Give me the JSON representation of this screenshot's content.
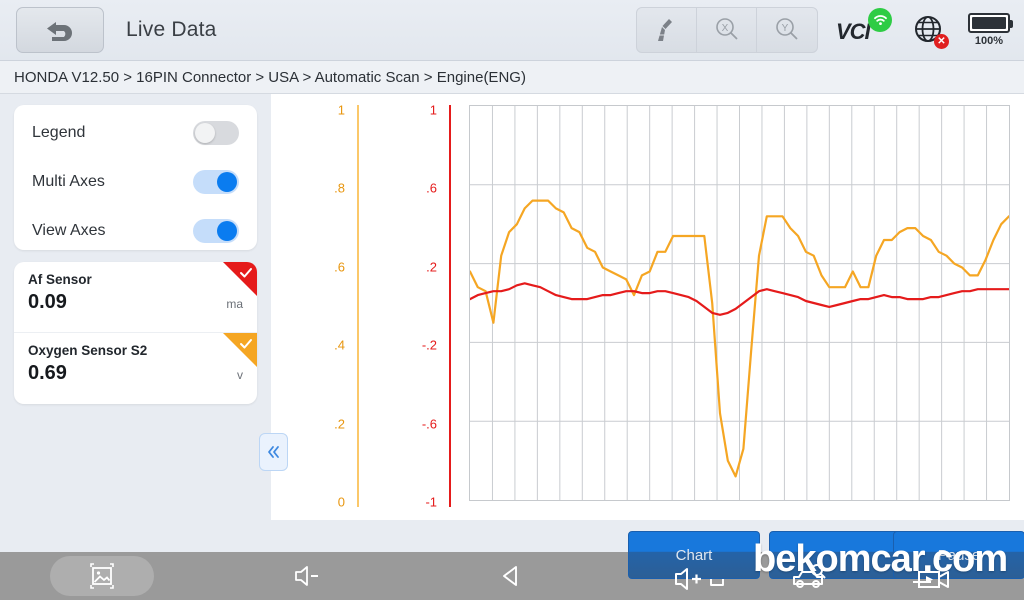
{
  "header": {
    "title": "Live Data",
    "back_icon": "back-arrow-icon",
    "tools": [
      {
        "id": "clear",
        "icon": "broom-clear-icon",
        "label": ""
      },
      {
        "id": "zoom-x",
        "icon": "magnifier-x-icon",
        "label": "X"
      },
      {
        "id": "zoom-y",
        "icon": "magnifier-y-icon",
        "label": "Y"
      }
    ],
    "vci": {
      "label": "VCI",
      "icon": "wifi-signal-icon",
      "color": "#2ecc45"
    },
    "network": {
      "icon": "globe-icon",
      "status_icon": "red-x-badge",
      "status_color": "#e02020"
    },
    "battery": {
      "icon": "battery-full-icon",
      "level": "100%",
      "fill_percent": 100
    }
  },
  "breadcrumb": {
    "text": "HONDA V12.50 > 16PIN Connector  > USA  > Automatic Scan  > Engine(ENG)"
  },
  "settings": {
    "items": [
      {
        "label": "Legend",
        "state": "off",
        "name": "legend"
      },
      {
        "label": "Multi Axes",
        "state": "on",
        "name": "multi-axes"
      },
      {
        "label": "View Axes",
        "state": "on",
        "name": "view-axes"
      }
    ]
  },
  "sensors": [
    {
      "name": "Af Sensor",
      "value": "0.09",
      "unit": "ma",
      "color": "#e51b1b",
      "selected": true
    },
    {
      "name": "Oxygen Sensor S2",
      "value": "0.69",
      "unit": "v",
      "color": "#f5a623",
      "selected": true
    }
  ],
  "collapse_button": {
    "glyph": "«",
    "name": "collapse-panel-icon"
  },
  "actions": [
    {
      "id": "chart",
      "label": "Chart"
    },
    {
      "id": "mid",
      "label": ""
    },
    {
      "id": "pause",
      "label": "Pause"
    }
  ],
  "navbar": [
    {
      "id": "screenshot",
      "icon": "screenshot-image-icon",
      "active": true
    },
    {
      "id": "volume-down",
      "icon": "volume-down-icon",
      "active": false
    },
    {
      "id": "back",
      "icon": "back-triangle-icon",
      "active": false
    },
    {
      "id": "home",
      "icon": "home-icon",
      "active": false
    },
    {
      "id": "recents",
      "icon": "menu-lines-icon",
      "active": false
    }
  ],
  "watermark": {
    "text": "bekomcar.com"
  },
  "watermark_icons": [
    {
      "id": "volume-up",
      "icon": "volume-up-icon"
    },
    {
      "id": "car-scan",
      "icon": "car-scan-icon"
    },
    {
      "id": "video-record",
      "icon": "video-record-icon"
    }
  ],
  "chart_data": {
    "type": "line",
    "title": "",
    "xlabel": "",
    "grid": true,
    "legend": "off",
    "axes": [
      {
        "name": "Oxygen Sensor S2",
        "color": "#f5a623",
        "unit": "v",
        "ylim": [
          0,
          1
        ],
        "ticks": [
          "1",
          ".8",
          ".6",
          ".4",
          ".2",
          "0"
        ],
        "tick_values": [
          1,
          0.8,
          0.6,
          0.4,
          0.2,
          0
        ]
      },
      {
        "name": "Af Sensor",
        "color": "#e51b1b",
        "unit": "ma",
        "ylim": [
          -1,
          1
        ],
        "ticks": [
          "1",
          ".6",
          ".2",
          "-.2",
          "-.6",
          "-1"
        ],
        "tick_values": [
          1,
          0.6,
          0.2,
          -0.2,
          -0.6,
          -1
        ]
      }
    ],
    "series": [
      {
        "name": "Oxygen Sensor S2",
        "color": "#f5a623",
        "axis": 0,
        "values": [
          0.58,
          0.54,
          0.53,
          0.45,
          0.62,
          0.68,
          0.7,
          0.74,
          0.76,
          0.76,
          0.76,
          0.74,
          0.73,
          0.69,
          0.68,
          0.64,
          0.63,
          0.59,
          0.58,
          0.57,
          0.56,
          0.52,
          0.57,
          0.58,
          0.63,
          0.63,
          0.67,
          0.67,
          0.67,
          0.67,
          0.67,
          0.5,
          0.22,
          0.1,
          0.06,
          0.13,
          0.38,
          0.62,
          0.72,
          0.72,
          0.72,
          0.69,
          0.67,
          0.63,
          0.62,
          0.57,
          0.54,
          0.54,
          0.54,
          0.58,
          0.54,
          0.54,
          0.62,
          0.66,
          0.66,
          0.68,
          0.69,
          0.69,
          0.67,
          0.66,
          0.63,
          0.62,
          0.6,
          0.59,
          0.57,
          0.57,
          0.61,
          0.66,
          0.7,
          0.72
        ]
      },
      {
        "name": "Af Sensor",
        "color": "#e51b1b",
        "axis": 1,
        "values": [
          0.02,
          0.04,
          0.05,
          0.06,
          0.06,
          0.07,
          0.09,
          0.1,
          0.09,
          0.08,
          0.06,
          0.04,
          0.03,
          0.02,
          0.02,
          0.02,
          0.03,
          0.04,
          0.04,
          0.05,
          0.06,
          0.06,
          0.05,
          0.05,
          0.06,
          0.06,
          0.05,
          0.04,
          0.03,
          0.01,
          -0.02,
          -0.05,
          -0.06,
          -0.05,
          -0.03,
          0.0,
          0.03,
          0.06,
          0.07,
          0.06,
          0.05,
          0.04,
          0.03,
          0.01,
          0.0,
          -0.01,
          -0.02,
          -0.01,
          0.0,
          0.01,
          0.02,
          0.02,
          0.03,
          0.04,
          0.03,
          0.03,
          0.02,
          0.02,
          0.02,
          0.03,
          0.03,
          0.04,
          0.05,
          0.06,
          0.06,
          0.07,
          0.07,
          0.07,
          0.07,
          0.07
        ]
      }
    ]
  }
}
